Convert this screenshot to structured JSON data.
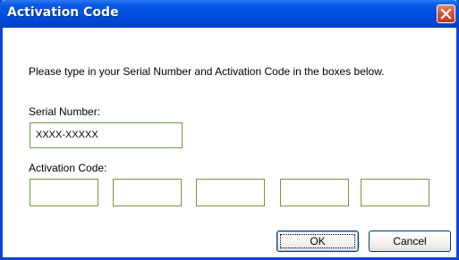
{
  "window": {
    "title": "Activation Code",
    "close_icon": "close-icon",
    "accent": "#0a46d6"
  },
  "form": {
    "instruction": "Please type in your Serial Number and Activation Code in the boxes below.",
    "serial_label": "Serial Number:",
    "serial_value": "XXXX-XXXXX",
    "activation_label": "Activation Code:",
    "activation_fields": [
      "",
      "",
      "",
      "",
      ""
    ]
  },
  "buttons": {
    "ok_label": "OK",
    "cancel_label": "Cancel"
  }
}
